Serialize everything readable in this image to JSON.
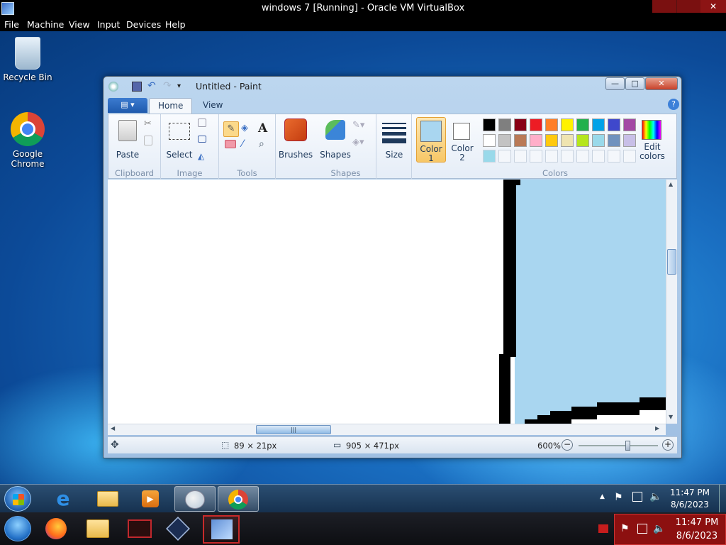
{
  "host": {
    "title": "windows 7 [Running] - Oracle VM VirtualBox",
    "menu": [
      "File",
      "Machine",
      "View",
      "Input",
      "Devices",
      "Help"
    ]
  },
  "desktop": {
    "icons": [
      {
        "label": "Recycle Bin"
      },
      {
        "label": "Google Chrome"
      }
    ]
  },
  "paint": {
    "title": "Untitled - Paint",
    "tabs": [
      "Home",
      "View"
    ],
    "groups": {
      "clipboard": {
        "label": "Clipboard",
        "paste": "Paste"
      },
      "image": {
        "label": "Image",
        "select": "Select"
      },
      "tools": {
        "label": "Tools"
      },
      "brushes": {
        "label": "Brushes"
      },
      "shapes": {
        "label": "Shapes",
        "button": "Shapes"
      },
      "size": {
        "label": "Size"
      },
      "color1": {
        "line1": "Color",
        "line2": "1"
      },
      "color2": {
        "line1": "Color",
        "line2": "2"
      },
      "colors": {
        "label": "Colors"
      },
      "edit_colors": {
        "line1": "Edit",
        "line2": "colors"
      }
    },
    "palette_row1": [
      "#000000",
      "#7f7f7f",
      "#880015",
      "#ed1c24",
      "#ff7f27",
      "#fff200",
      "#22b14c",
      "#00a2e8",
      "#3f48cc",
      "#a349a4"
    ],
    "palette_row2": [
      "#ffffff",
      "#c3c3c3",
      "#b97a57",
      "#ffaec9",
      "#ffc90e",
      "#efe4b0",
      "#b5e61d",
      "#99d9ea",
      "#7092be",
      "#c8bfe7"
    ],
    "palette_row3_first": "#99d9ea",
    "color1_value": "#a9d6f0",
    "color2_value": "#ffffff",
    "status": {
      "selection": "89 × 21px",
      "canvas_size": "905 × 471px",
      "zoom": "600%"
    }
  },
  "taskbar": {
    "clock_time": "11:47 PM",
    "clock_date": "8/6/2023"
  },
  "host_taskbar": {
    "clock_time": "11:47 PM",
    "clock_date": "8/6/2023"
  }
}
